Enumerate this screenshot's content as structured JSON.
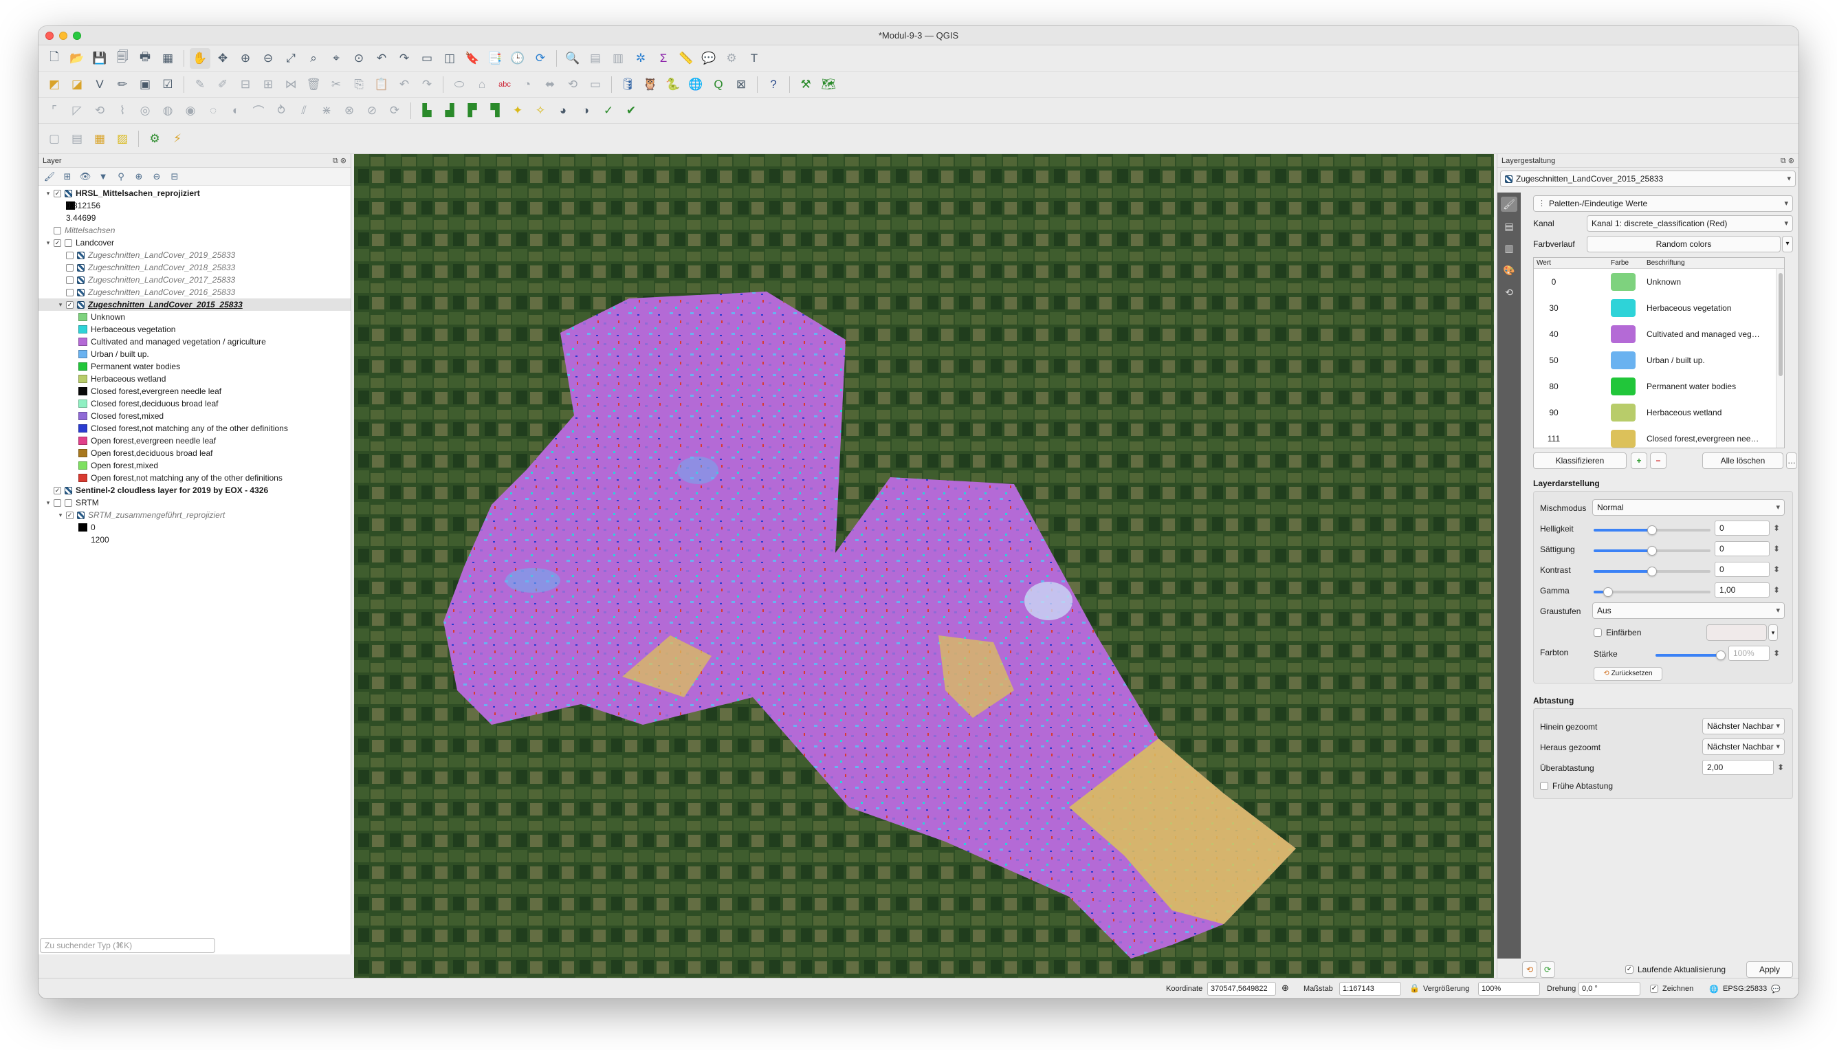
{
  "window": {
    "title": "*Modul-9-3 — QGIS"
  },
  "layers_panel": {
    "title": "Layer",
    "search_placeholder": "Zu suchender Typ (⌘K)",
    "tree": [
      {
        "label": "HRSL_Mittelsachen_reprojiziert",
        "bold": true,
        "checked": true,
        "expanded": true,
        "indent": 0,
        "icon": "raster-icon"
      },
      {
        "label": "0.812156",
        "indent": 1,
        "swatch": "#000000"
      },
      {
        "label": "3.44699",
        "indent": 1
      },
      {
        "label": "Mittelsachsen",
        "italic": true,
        "checked": false,
        "indent": 0
      },
      {
        "label": "Landcover",
        "checked": true,
        "expanded": true,
        "indent": 0,
        "icon": "group-icon"
      },
      {
        "label": "Zugeschnitten_LandCover_2019_25833",
        "italic": true,
        "checked": false,
        "indent": 1,
        "icon": "raster-icon"
      },
      {
        "label": "Zugeschnitten_LandCover_2018_25833",
        "italic": true,
        "checked": false,
        "indent": 1,
        "icon": "raster-icon"
      },
      {
        "label": "Zugeschnitten_LandCover_2017_25833",
        "italic": true,
        "checked": false,
        "indent": 1,
        "icon": "raster-icon"
      },
      {
        "label": "Zugeschnitten_LandCover_2016_25833",
        "italic": true,
        "checked": false,
        "indent": 1,
        "icon": "raster-icon"
      },
      {
        "label": "Zugeschnitten_LandCover_2015_25833",
        "bold": true,
        "italic": true,
        "underline": true,
        "checked": true,
        "expanded": true,
        "selected": true,
        "indent": 1,
        "icon": "raster-icon"
      },
      {
        "label": "Unknown",
        "indent": 2,
        "swatch": "#7ed27e"
      },
      {
        "label": "Herbaceous vegetation",
        "indent": 2,
        "swatch": "#2ed3d8"
      },
      {
        "label": "Cultivated and managed vegetation / agriculture",
        "indent": 2,
        "swatch": "#b46ad6"
      },
      {
        "label": "Urban / built up.",
        "indent": 2,
        "swatch": "#6ab2f0"
      },
      {
        "label": "Permanent water bodies",
        "indent": 2,
        "swatch": "#21c63a"
      },
      {
        "label": "Herbaceous wetland",
        "indent": 2,
        "swatch": "#b8cc6a"
      },
      {
        "label": "Closed forest,evergreen needle leaf",
        "indent": 2,
        "swatch": "#0a0a0a"
      },
      {
        "label": "Closed forest,deciduous broad leaf",
        "indent": 2,
        "swatch": "#8ff0c2"
      },
      {
        "label": "Closed forest,mixed",
        "indent": 2,
        "swatch": "#8f6ad6"
      },
      {
        "label": "Closed forest,not matching any of the other definitions",
        "indent": 2,
        "swatch": "#2a3bd0"
      },
      {
        "label": "Open forest,evergreen needle leaf",
        "indent": 2,
        "swatch": "#e0408a"
      },
      {
        "label": "Open forest,deciduous broad leaf",
        "indent": 2,
        "swatch": "#a8781e"
      },
      {
        "label": "Open forest,mixed",
        "indent": 2,
        "swatch": "#7ee060"
      },
      {
        "label": "Open forest,not matching any of the other definitions",
        "indent": 2,
        "swatch": "#d83a30"
      },
      {
        "label": "Sentinel-2 cloudless layer for 2019 by EOX - 4326",
        "bold": true,
        "checked": true,
        "indent": 0,
        "icon": "raster-icon"
      },
      {
        "label": "SRTM",
        "checked": false,
        "expanded": true,
        "indent": 0,
        "icon": "group-icon"
      },
      {
        "label": "SRTM_zusammengeführt_reprojiziert",
        "italic": true,
        "checked": true,
        "expanded": true,
        "indent": 1,
        "icon": "raster-icon"
      },
      {
        "label": "0",
        "indent": 2,
        "swatch": "#000000"
      },
      {
        "label": "1200",
        "indent": 2
      }
    ]
  },
  "style_panel": {
    "title": "Layergestaltung",
    "layer": "Zugeschnitten_LandCover_2015_25833",
    "renderer": "Paletten-/Eindeutige Werte",
    "band_label": "Kanal",
    "band_value": "Kanal 1: discrete_classification (Red)",
    "ramp_label": "Farbverlauf",
    "ramp_value": "Random colors",
    "table_headers": {
      "value": "Wert",
      "color": "Farbe",
      "label": "Beschriftung"
    },
    "palette": [
      {
        "value": "0",
        "color": "#7ed27e",
        "label": "Unknown"
      },
      {
        "value": "30",
        "color": "#2ed3d8",
        "label": "Herbaceous vegetation"
      },
      {
        "value": "40",
        "color": "#b46ad6",
        "label": "Cultivated and managed veg…"
      },
      {
        "value": "50",
        "color": "#6ab2f0",
        "label": "Urban / built up."
      },
      {
        "value": "80",
        "color": "#21c63a",
        "label": "Permanent water bodies"
      },
      {
        "value": "90",
        "color": "#b8cc6a",
        "label": "Herbaceous wetland"
      },
      {
        "value": "111",
        "color": "#dcc15a",
        "label": "Closed forest,evergreen nee…"
      }
    ],
    "classify_button": "Klassifizieren",
    "delete_all_button": "Alle löschen",
    "rendering_title": "Layerdarstellung",
    "blend_label": "Mischmodus",
    "blend_value": "Normal",
    "brightness_label": "Helligkeit",
    "brightness_value": "0",
    "saturation_label": "Sättigung",
    "saturation_value": "0",
    "contrast_label": "Kontrast",
    "contrast_value": "0",
    "gamma_label": "Gamma",
    "gamma_value": "1,00",
    "grayscale_label": "Graustufen",
    "grayscale_value": "Aus",
    "hue_label": "Farbton",
    "colorize_label": "Einfärben",
    "strength_label": "Stärke",
    "strength_value": "100%",
    "reset_button": "Zurücksetzen",
    "resampling_title": "Abtastung",
    "zoom_in_label": "Hinein gezoomt",
    "zoom_in_value": "Nächster Nachbar",
    "zoom_out_label": "Heraus gezoomt",
    "zoom_out_value": "Nächster Nachbar",
    "oversampling_label": "Überabtastung",
    "oversampling_value": "2,00",
    "early_resampling_label": "Frühe Abtastung",
    "live_update_label": "Laufende Aktualisierung",
    "apply_button": "Apply"
  },
  "statusbar": {
    "coordinate_label": "Koordinate",
    "coordinate_value": "370547,5649822",
    "scale_label": "Maßstab",
    "scale_value": "1:167143",
    "magnifier_label": "Vergrößerung",
    "magnifier_value": "100%",
    "rotation_label": "Drehung",
    "rotation_value": "0,0 °",
    "render_label": "Zeichnen",
    "crs_label": "EPSG:25833"
  },
  "colors": {
    "agriculture": "#b46ad6",
    "forest_mixed": "#8f6ad6",
    "wetland_yellow": "#dcc15a",
    "urban": "#6ab2f0",
    "herbaceous": "#2ed3d8",
    "open_forest_red": "#d83a30",
    "imagery_dark": "#2e4a26"
  }
}
